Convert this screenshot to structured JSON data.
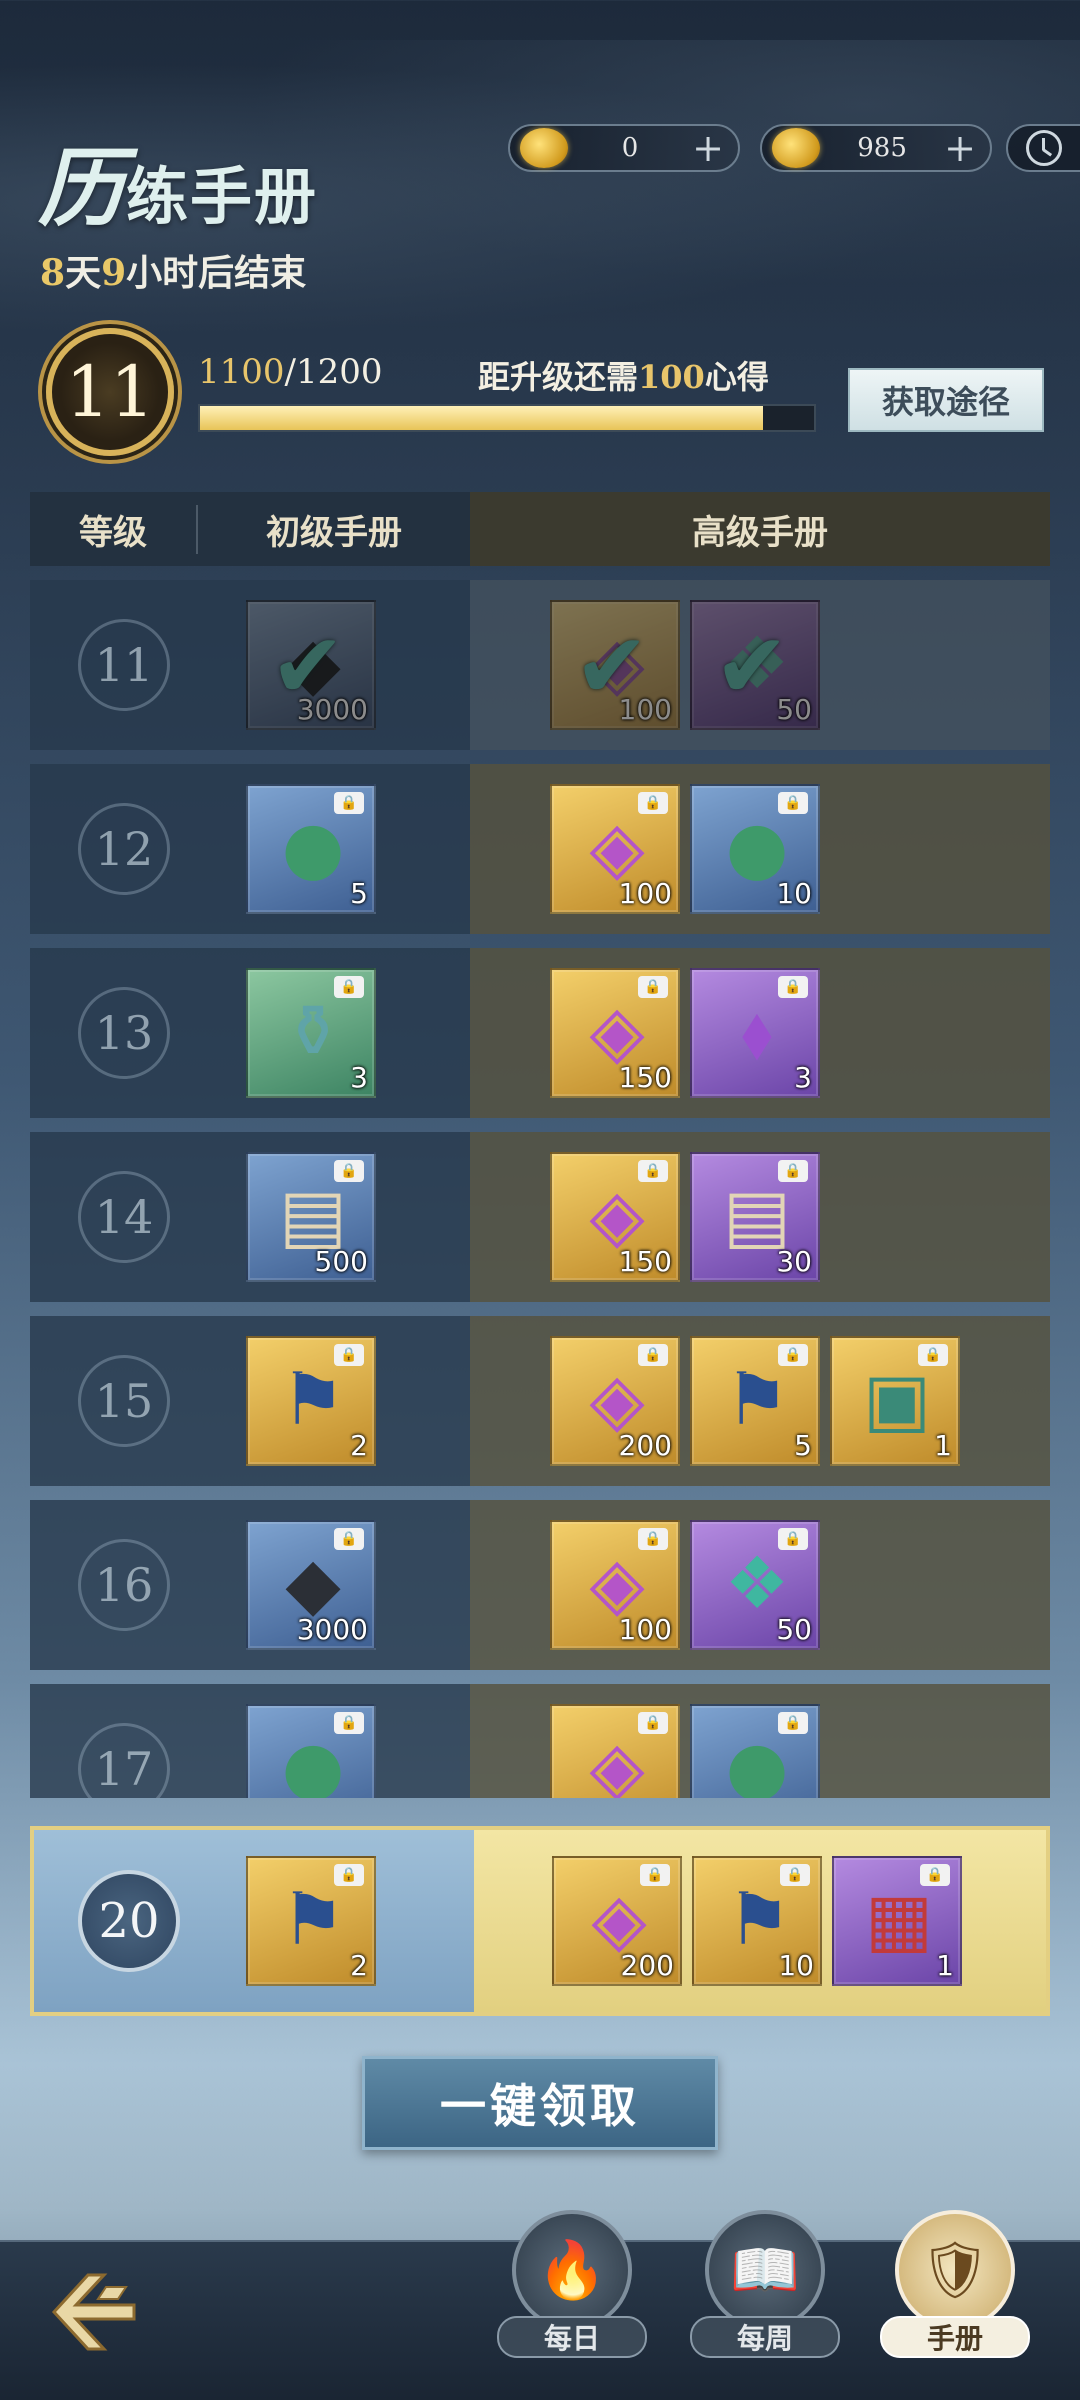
{
  "header": {
    "title_big": "历",
    "title_rest": "练手册",
    "countdown_days": "8",
    "countdown_days_unit": "天",
    "countdown_hours": "9",
    "countdown_hours_unit": "小时",
    "countdown_suffix": "后结束"
  },
  "currencies": [
    {
      "value": "0",
      "plus": "+",
      "icon": "gold-ingot-icon"
    },
    {
      "value": "985",
      "plus": "+",
      "icon": "gold-coin-icon"
    }
  ],
  "level": {
    "current": "11",
    "xp_current": "1100",
    "xp_total": "/1200",
    "xp_progress": 0.9167,
    "need_prefix": "距升级还需",
    "need_amount": "100",
    "need_suffix": "心得",
    "get_button": "获取途径"
  },
  "table": {
    "col_level": "等级",
    "col_basic": "初级手册",
    "col_advanced": "高级手册"
  },
  "rows": [
    {
      "level": "11",
      "claimed": true,
      "basic": [
        {
          "qty": "3000",
          "color": "blue",
          "icon": "ore-icon"
        }
      ],
      "advanced": [
        {
          "qty": "100",
          "color": "gold",
          "icon": "token-icon"
        },
        {
          "qty": "50",
          "color": "purple",
          "icon": "crystal-icon"
        }
      ]
    },
    {
      "level": "12",
      "claimed": false,
      "basic": [
        {
          "qty": "5",
          "color": "blue",
          "icon": "pouch-icon"
        }
      ],
      "advanced": [
        {
          "qty": "100",
          "color": "gold",
          "icon": "token-icon"
        },
        {
          "qty": "10",
          "color": "blue",
          "icon": "pouch-icon"
        }
      ]
    },
    {
      "level": "13",
      "claimed": false,
      "basic": [
        {
          "qty": "3",
          "color": "green",
          "icon": "vase-icon"
        }
      ],
      "advanced": [
        {
          "qty": "150",
          "color": "gold",
          "icon": "token-icon"
        },
        {
          "qty": "3",
          "color": "purple",
          "icon": "gem-icon"
        }
      ]
    },
    {
      "level": "14",
      "claimed": false,
      "basic": [
        {
          "qty": "500",
          "color": "blue",
          "icon": "scroll-icon"
        }
      ],
      "advanced": [
        {
          "qty": "150",
          "color": "gold",
          "icon": "token-icon"
        },
        {
          "qty": "30",
          "color": "purple",
          "icon": "scroll-icon"
        }
      ]
    },
    {
      "level": "15",
      "claimed": false,
      "basic": [
        {
          "qty": "2",
          "color": "gold",
          "icon": "flag-icon"
        }
      ],
      "advanced": [
        {
          "qty": "200",
          "color": "gold",
          "icon": "token-icon"
        },
        {
          "qty": "5",
          "color": "gold",
          "icon": "flag-icon"
        },
        {
          "qty": "1",
          "color": "gold",
          "icon": "book-icon"
        }
      ]
    },
    {
      "level": "16",
      "claimed": false,
      "basic": [
        {
          "qty": "3000",
          "color": "blue",
          "icon": "ore-icon"
        }
      ],
      "advanced": [
        {
          "qty": "100",
          "color": "gold",
          "icon": "token-icon"
        },
        {
          "qty": "50",
          "color": "purple",
          "icon": "crystal-icon"
        }
      ]
    },
    {
      "level": "17",
      "claimed": false,
      "basic": [
        {
          "qty": "",
          "color": "blue",
          "icon": "pouch-icon"
        }
      ],
      "advanced": [
        {
          "qty": "",
          "color": "gold",
          "icon": "token-icon"
        },
        {
          "qty": "",
          "color": "blue",
          "icon": "pouch-icon"
        }
      ]
    }
  ],
  "highlight_row": {
    "level": "20",
    "basic": [
      {
        "qty": "2",
        "color": "gold",
        "icon": "flag-icon"
      }
    ],
    "advanced": [
      {
        "qty": "200",
        "color": "gold",
        "icon": "token-icon"
      },
      {
        "qty": "10",
        "color": "gold",
        "icon": "flag-icon"
      },
      {
        "qty": "1",
        "color": "purple",
        "icon": "chest-icon"
      }
    ]
  },
  "claim_all_button": "一键领取",
  "nav": {
    "daily": "每日",
    "weekly": "每周",
    "handbook": "手册"
  },
  "colors": {
    "accent_gold": "#e8c56b",
    "check_teal": "#36c8b0"
  }
}
